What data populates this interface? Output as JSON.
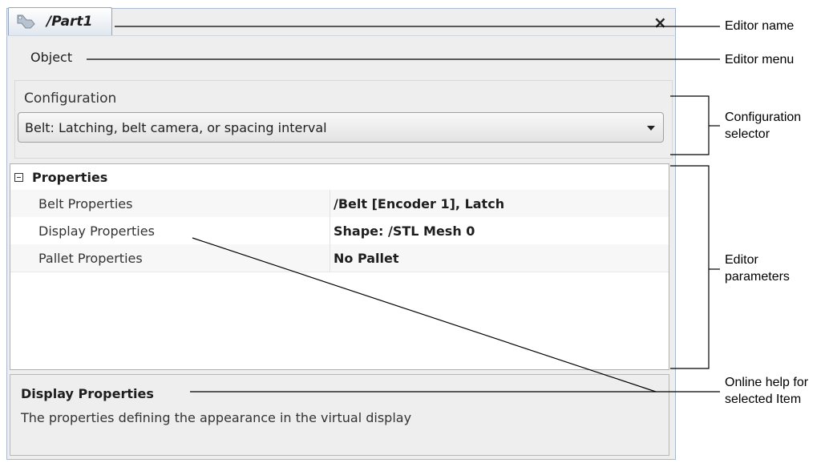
{
  "editor": {
    "tab_title": "/Part1",
    "close_glyph": "×",
    "menu_object": "Object"
  },
  "configuration": {
    "label": "Configuration",
    "selected": "Belt: Latching, belt camera, or spacing interval"
  },
  "properties": {
    "category": "Properties",
    "rows": [
      {
        "name": "Belt Properties",
        "value": "/Belt [Encoder 1], Latch"
      },
      {
        "name": "Display Properties",
        "value": "Shape: /STL Mesh 0"
      },
      {
        "name": "Pallet Properties",
        "value": "No Pallet"
      }
    ]
  },
  "help": {
    "title": "Display Properties",
    "description": "The properties defining the appearance in the virtual display"
  },
  "callouts": {
    "editor_name": "Editor name",
    "editor_menu": "Editor menu",
    "config_selector_1": "Configuration",
    "config_selector_2": "selector",
    "editor_params_1": "Editor",
    "editor_params_2": "parameters",
    "online_help_1": "Online help for",
    "online_help_2": "selected Item"
  },
  "icons": {
    "tab": "part-wrench-icon",
    "close": "close-icon",
    "combo_arrow": "chevron-down-icon",
    "expander": "collapse-minus-icon"
  }
}
